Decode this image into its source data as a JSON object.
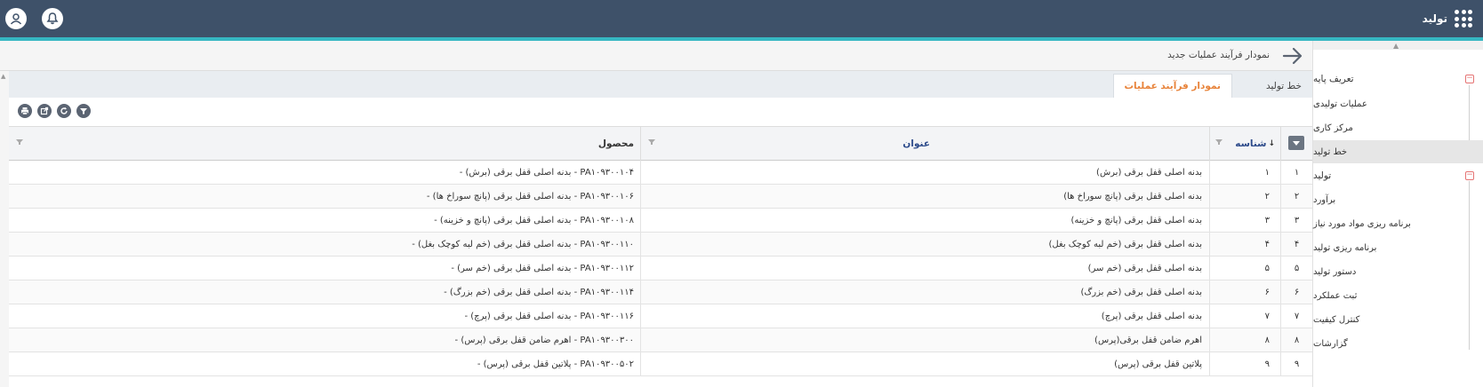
{
  "app": {
    "title": "تولید"
  },
  "header": {
    "page_title": "نمودار فرآیند عملیات جدید"
  },
  "sidebar": {
    "items": [
      {
        "label": "تعریف پایه",
        "type": "group"
      },
      {
        "label": "عملیات تولیدی",
        "type": "item"
      },
      {
        "label": "مرکز کاری",
        "type": "item"
      },
      {
        "label": "خط تولید",
        "type": "item",
        "active": true
      },
      {
        "label": "تولید",
        "type": "group"
      },
      {
        "label": "برآورد",
        "type": "item"
      },
      {
        "label": "برنامه ریزی مواد مورد نیاز",
        "type": "item"
      },
      {
        "label": "برنامه ریزی تولید",
        "type": "item"
      },
      {
        "label": "دستور تولید",
        "type": "item"
      },
      {
        "label": "ثبت عملکرد",
        "type": "item"
      },
      {
        "label": "کنترل کیفیت",
        "type": "item"
      },
      {
        "label": "گزارشات",
        "type": "item"
      }
    ]
  },
  "tabs": [
    {
      "label": "خط تولید",
      "active": false
    },
    {
      "label": "نمودار فرآیند عملیات",
      "active": true
    }
  ],
  "toolbar": [
    "filter-icon",
    "refresh-icon",
    "export-icon",
    "print-icon"
  ],
  "table": {
    "columns": {
      "id": "شناسه",
      "title": "عنوان",
      "product": "محصول"
    },
    "rows": [
      {
        "num": "۱",
        "id": "۱",
        "title": "بدنه اصلی قفل برقی (برش)",
        "product": "PA۱۰۹۳۰۰۱۰۴ - بدنه اصلی قفل برقی (برش) -"
      },
      {
        "num": "۲",
        "id": "۲",
        "title": "بدنه اصلی قفل برقی (پانچ سوراخ ها)",
        "product": "PA۱۰۹۳۰۰۱۰۶ - بدنه اصلی قفل برقی (پانچ سوراخ ها) -"
      },
      {
        "num": "۳",
        "id": "۳",
        "title": "بدنه اصلی قفل برقی (پانچ و خزینه)",
        "product": "PA۱۰۹۳۰۰۱۰۸ - بدنه اصلی قفل برقی (پانچ و خزینه) -"
      },
      {
        "num": "۴",
        "id": "۴",
        "title": "بدنه اصلی قفل برقی (خم لبه کوچک بغل)",
        "product": "PA۱۰۹۳۰۰۱۱۰ - بدنه اصلی قفل برقی (خم لبه کوچک بغل) -"
      },
      {
        "num": "۵",
        "id": "۵",
        "title": "بدنه اصلی قفل برقی (خم سر)",
        "product": "PA۱۰۹۳۰۰۱۱۲ - بدنه اصلی قفل برقی (خم سر) -"
      },
      {
        "num": "۶",
        "id": "۶",
        "title": "بدنه اصلی قفل برقی (خم بزرگ)",
        "product": "PA۱۰۹۳۰۰۱۱۴ - بدنه اصلی قفل برقی (خم بزرگ) -"
      },
      {
        "num": "۷",
        "id": "۷",
        "title": "بدنه اصلی قفل برقی (پرچ)",
        "product": "PA۱۰۹۳۰۰۱۱۶ - بدنه اصلی قفل برقی (پرچ) -"
      },
      {
        "num": "۸",
        "id": "۸",
        "title": "اهرم ضامن قفل برقی(پرس)",
        "product": "PA۱۰۹۳۰۰۳۰۰ - اهرم ضامن قفل برقی (پرس) -"
      },
      {
        "num": "۹",
        "id": "۹",
        "title": "پلاتین قفل برقی (پرس)",
        "product": "PA۱۰۹۳۰۰۵۰۲ - پلاتین قفل برقی (پرس) -"
      }
    ]
  }
}
